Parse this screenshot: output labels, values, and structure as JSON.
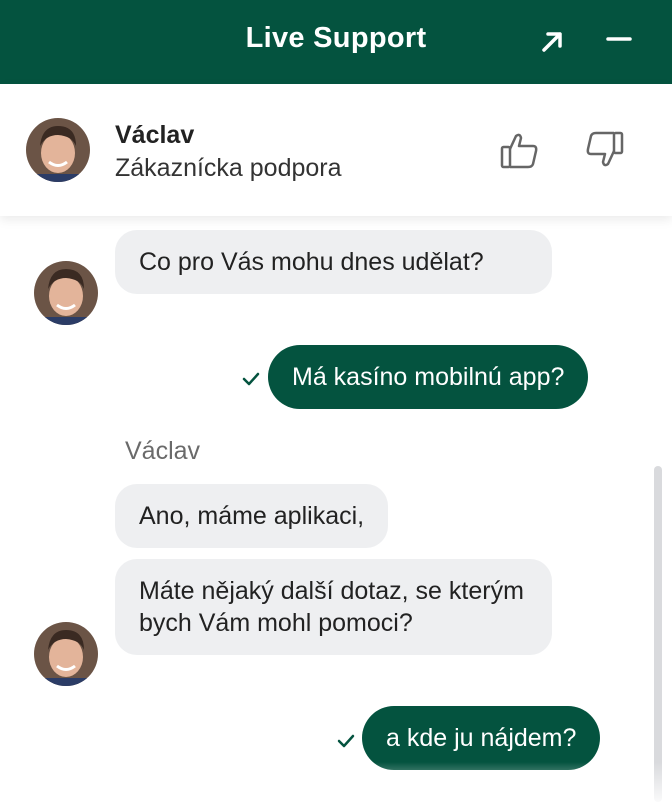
{
  "header": {
    "title": "Live Support",
    "expand_icon": "arrow-up-right-icon",
    "minimize_icon": "minus-icon"
  },
  "agent": {
    "name": "Václav",
    "role": "Zákaznícka podpora",
    "avatar_icon": "agent-avatar"
  },
  "rating": {
    "up_icon": "thumbs-up-icon",
    "down_icon": "thumbs-down-icon"
  },
  "messages": [
    {
      "from": "agent",
      "text": "Co pro Vás mohu dnes udělat?"
    },
    {
      "from": "user",
      "text": "Má kasíno mobilnú app?",
      "status_icon": "check-icon"
    },
    {
      "from": "agent",
      "sender": "Václav",
      "text": "Ano, máme aplikaci,"
    },
    {
      "from": "agent",
      "text": "Máte nějaký další dotaz, se kterým bych Vám mohl pomoci?"
    },
    {
      "from": "user",
      "text": "a kde ju nájdem?",
      "status_icon": "check-icon"
    }
  ],
  "colors": {
    "brand": "#04533f",
    "incoming_bubble": "#eeeff1",
    "text": "#222222"
  }
}
